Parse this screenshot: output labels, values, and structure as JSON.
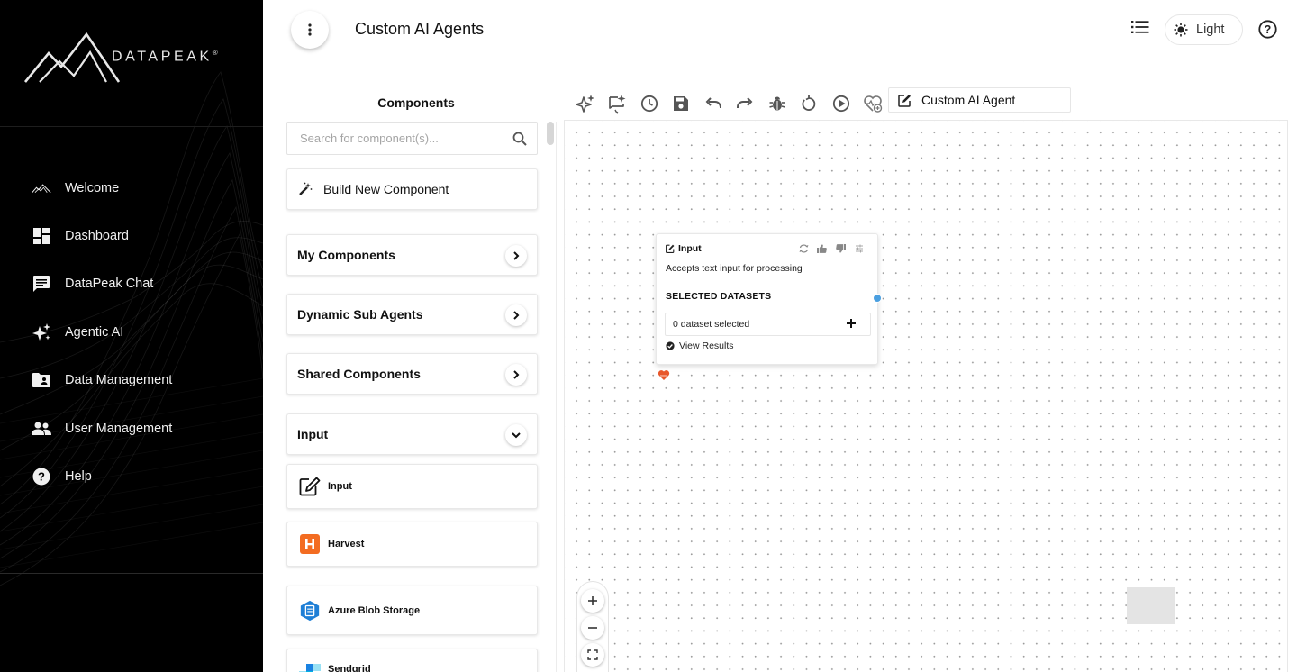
{
  "brand": {
    "name": "DATAPEAK",
    "mark": "®"
  },
  "sidebar": {
    "items": [
      {
        "label": "Welcome",
        "icon": "mountain-icon"
      },
      {
        "label": "Dashboard",
        "icon": "dashboard-icon"
      },
      {
        "label": "DataPeak Chat",
        "icon": "chat-icon"
      },
      {
        "label": "Agentic AI",
        "icon": "sparkle-icon"
      },
      {
        "label": "Data Management",
        "icon": "folder-user-icon"
      },
      {
        "label": "User Management",
        "icon": "people-icon"
      },
      {
        "label": "Help",
        "icon": "help-icon"
      }
    ]
  },
  "header": {
    "title": "Custom AI Agents",
    "theme_label": "Light"
  },
  "components_panel": {
    "title": "Components",
    "search_placeholder": "Search for component(s)...",
    "build_label": "Build New Component",
    "sections": [
      {
        "label": "My Components",
        "state": "collapsed"
      },
      {
        "label": "Dynamic Sub Agents",
        "state": "collapsed"
      },
      {
        "label": "Shared Components",
        "state": "collapsed"
      },
      {
        "label": "Input",
        "state": "expanded"
      }
    ],
    "items": [
      {
        "label": "Input",
        "icon": "edit-icon"
      },
      {
        "label": "Harvest",
        "icon": "harvest-icon",
        "color": "#f36c21"
      },
      {
        "label": "Azure Blob Storage",
        "icon": "azure-blob-icon",
        "color": "#1f7fd6"
      },
      {
        "label": "Sendgrid",
        "icon": "sendgrid-icon",
        "color": "#1a82e2"
      }
    ]
  },
  "toolbar": {
    "agent_name": "Custom AI Agent",
    "tools": [
      "sparkle-icon",
      "ai-chat-icon",
      "history-icon",
      "save-icon",
      "undo-icon",
      "redo-icon",
      "debug-icon",
      "reset-icon",
      "run-icon",
      "health-icon"
    ]
  },
  "node": {
    "title": "Input",
    "description": "Accepts text input for processing",
    "section_label": "SELECTED DATASETS",
    "dataset_status": "0 dataset selected",
    "results_label": "View Results"
  },
  "colors": {
    "sidebar_bg": "#000000",
    "accent_blue": "#4a9fe0",
    "heart": "#e8572a"
  }
}
